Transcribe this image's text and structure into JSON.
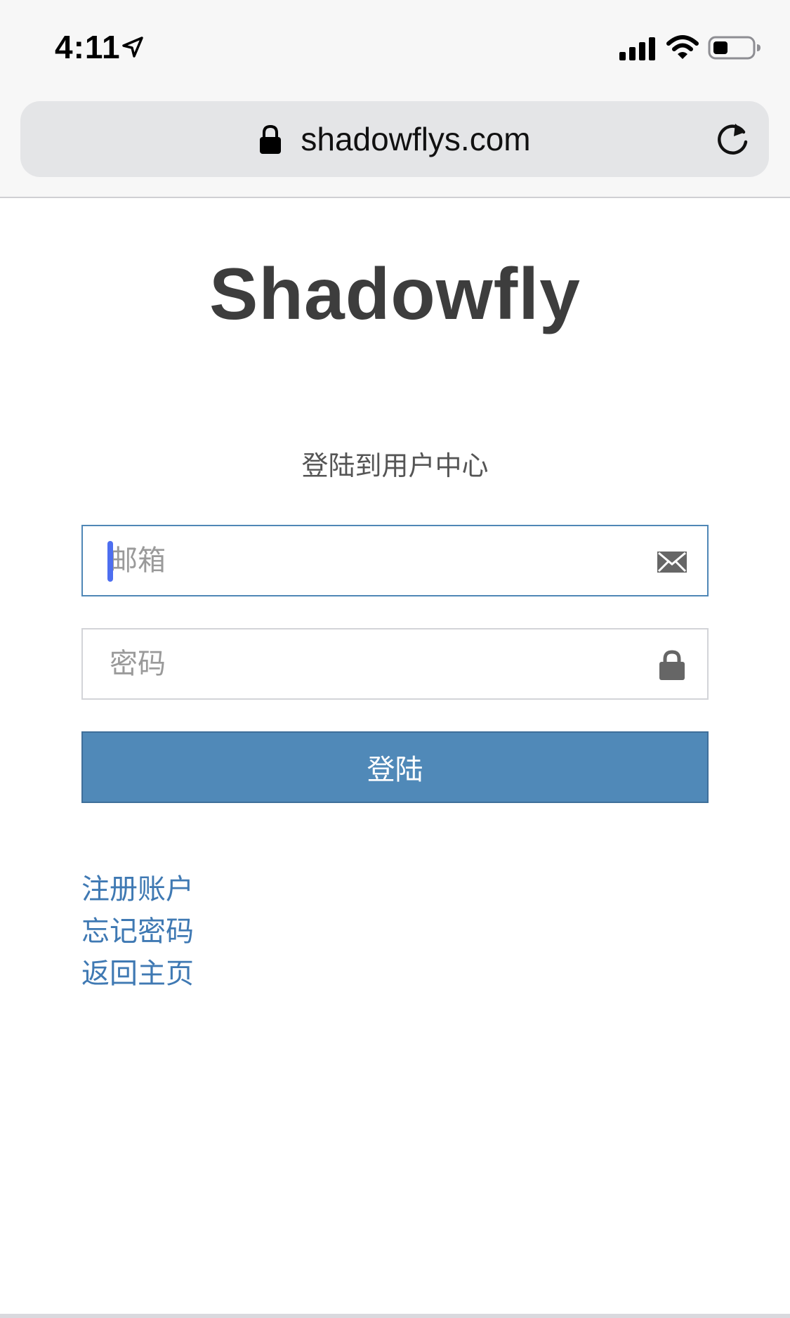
{
  "status_bar": {
    "time": "4:11"
  },
  "address_bar": {
    "url": "shadowflys.com"
  },
  "page": {
    "brand": "Shadowfly",
    "subtitle": "登陆到用户中心",
    "email_placeholder": "邮箱",
    "password_placeholder": "密码",
    "login_label": "登陆",
    "links": [
      {
        "label": "注册账户"
      },
      {
        "label": "忘记密码"
      },
      {
        "label": "返回主页"
      }
    ]
  },
  "colors": {
    "accent": "#5089b8",
    "link": "#3f79b3",
    "caret": "#4d6ef0"
  },
  "icons": {
    "location": "location-arrow-icon",
    "signal": "cellular-signal-icon",
    "wifi": "wifi-icon",
    "battery": "battery-icon",
    "lock": "lock-icon",
    "reload": "reload-icon",
    "email": "envelope-icon",
    "password": "lock-icon"
  }
}
